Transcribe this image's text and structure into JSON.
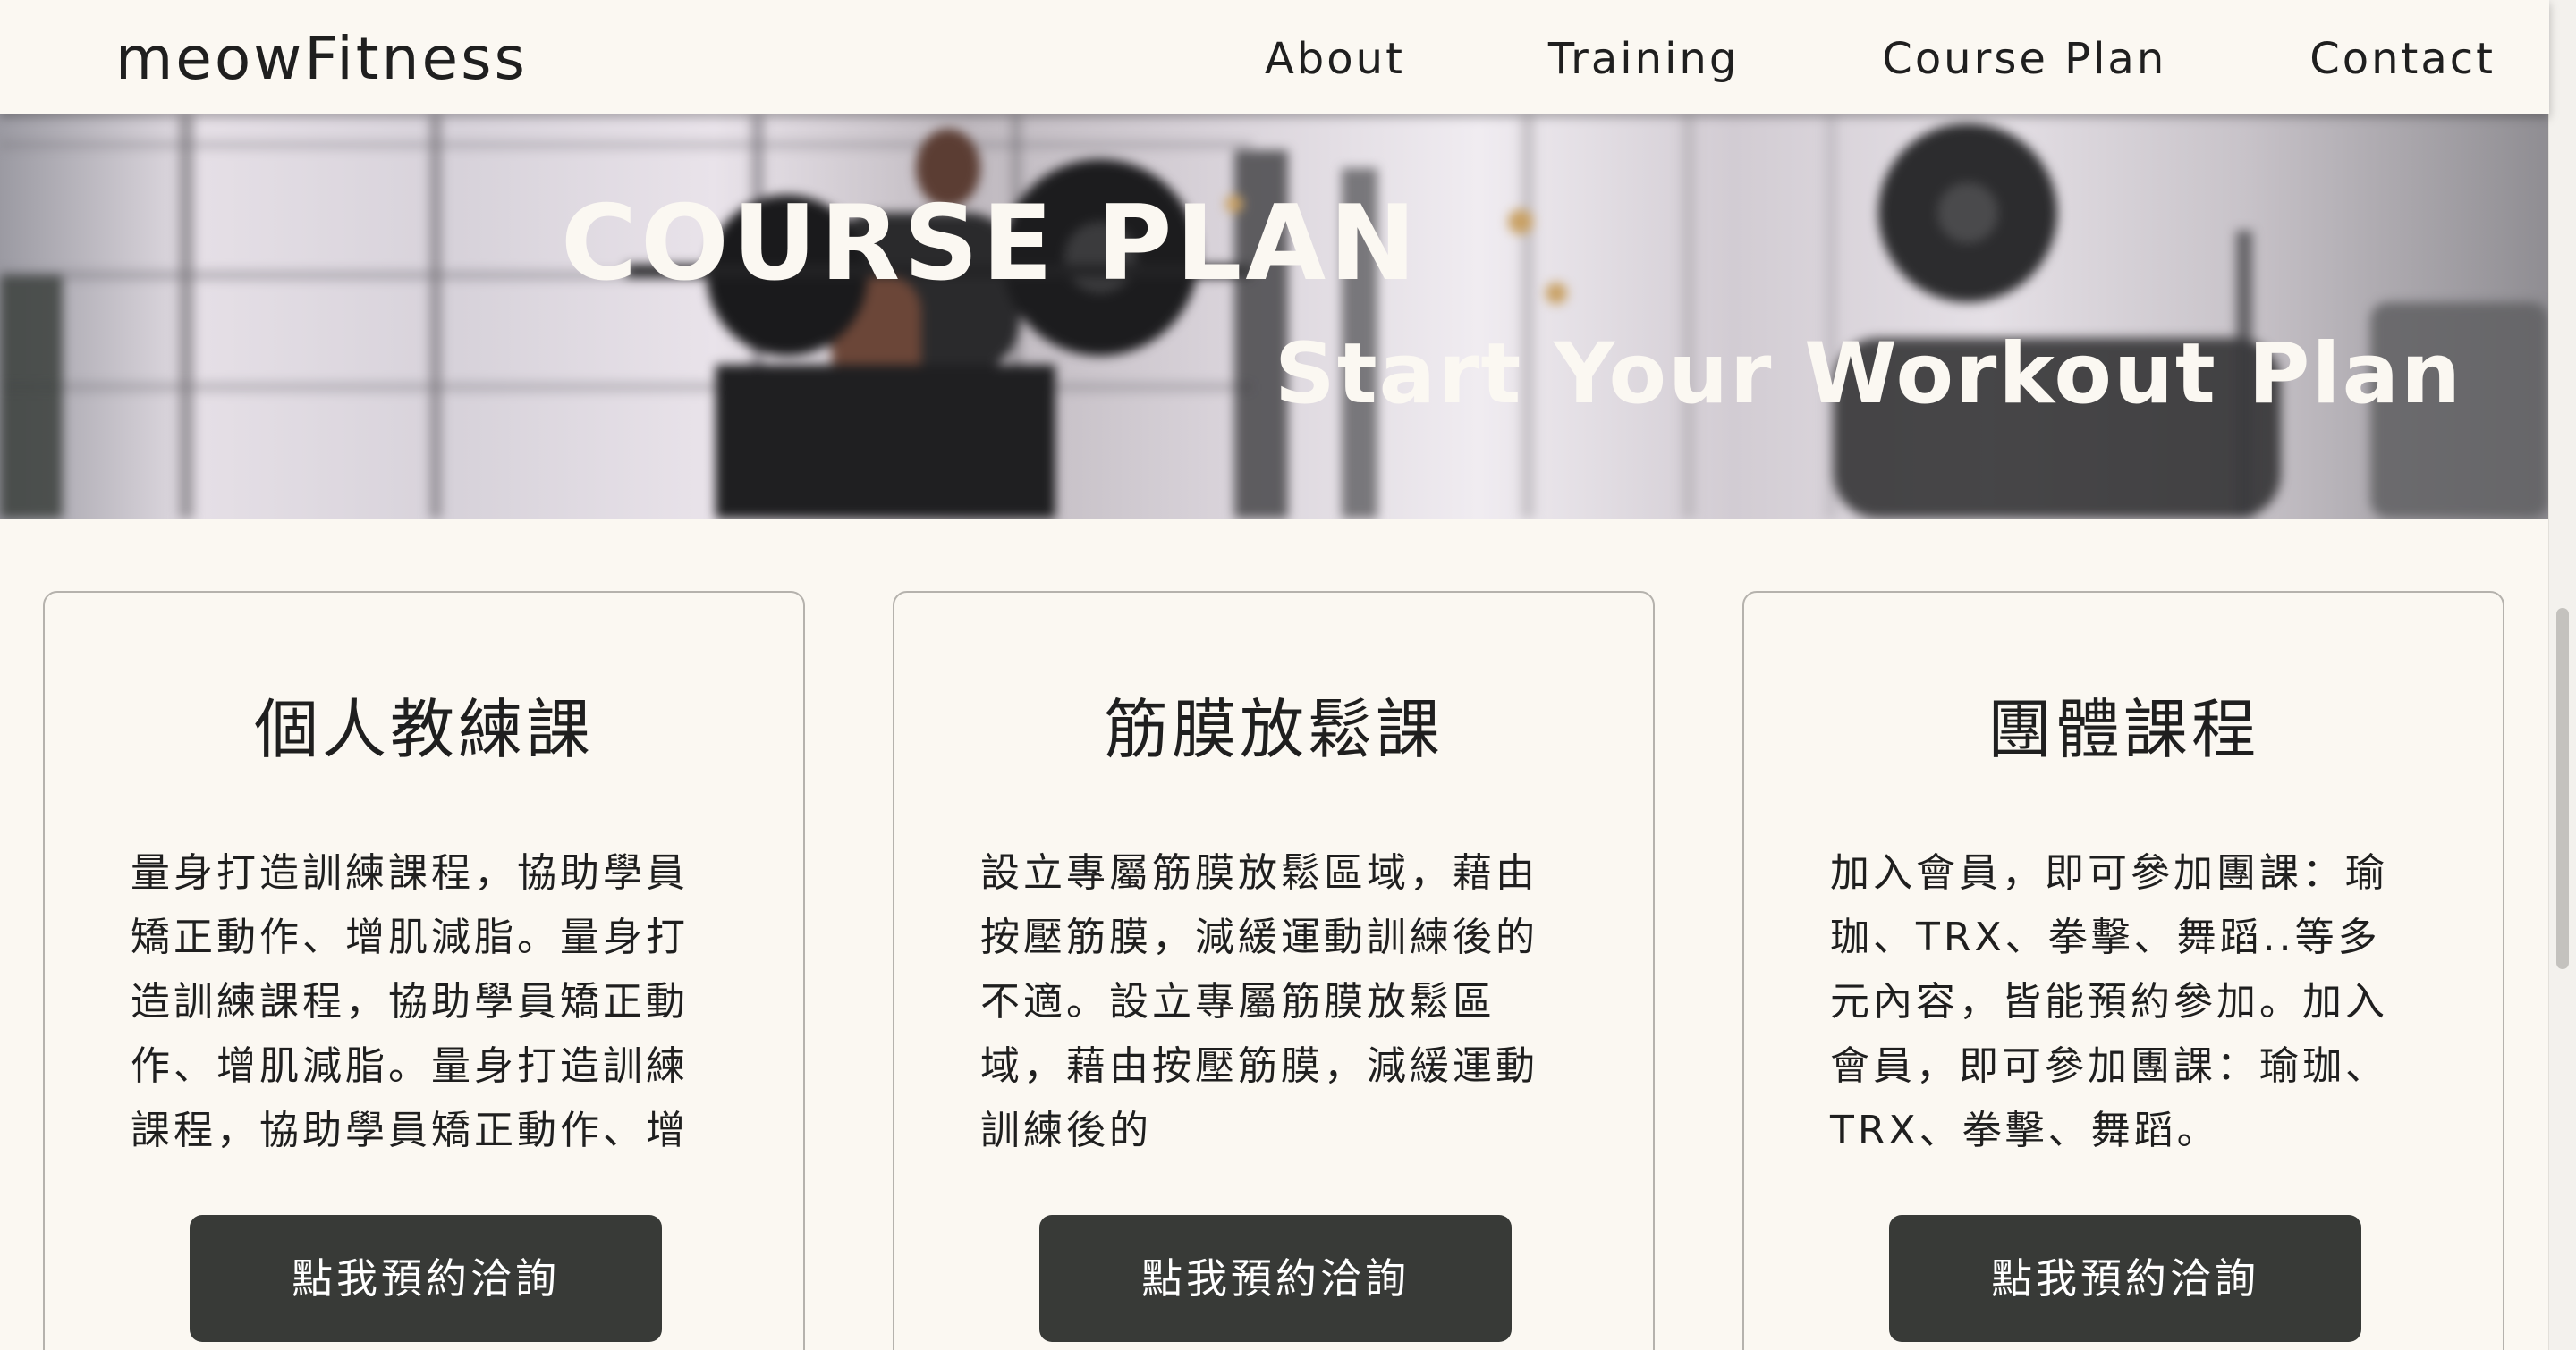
{
  "header": {
    "logo": "meowFitness",
    "nav": [
      "About",
      "Training",
      "Course Plan",
      "Contact"
    ]
  },
  "hero": {
    "title": "COURSE PLAN",
    "subtitle": "Start Your Workout Plan"
  },
  "cards": [
    {
      "title": "個人教練課",
      "text": "量身打造訓練課程，協助學員矯正動作、增肌減脂。量身打造訓練課程，協助學員矯正動作、增肌減脂。量身打造訓練課程，協助學員矯正動作、增",
      "button": "點我預約洽詢"
    },
    {
      "title": "筋膜放鬆課",
      "text": "設立專屬筋膜放鬆區域，藉由按壓筋膜，減緩運動訓練後的不適。設立專屬筋膜放鬆區域，藉由按壓筋膜，減緩運動訓練後的",
      "button": "點我預約洽詢"
    },
    {
      "title": "團體課程",
      "text": "加入會員，即可參加團課：瑜珈、TRX、拳擊、舞蹈..等多元內容，皆能預約參加。加入會員，即可參加團課：瑜珈、TRX、拳擊、舞蹈。",
      "button": "點我預約洽詢"
    }
  ]
}
